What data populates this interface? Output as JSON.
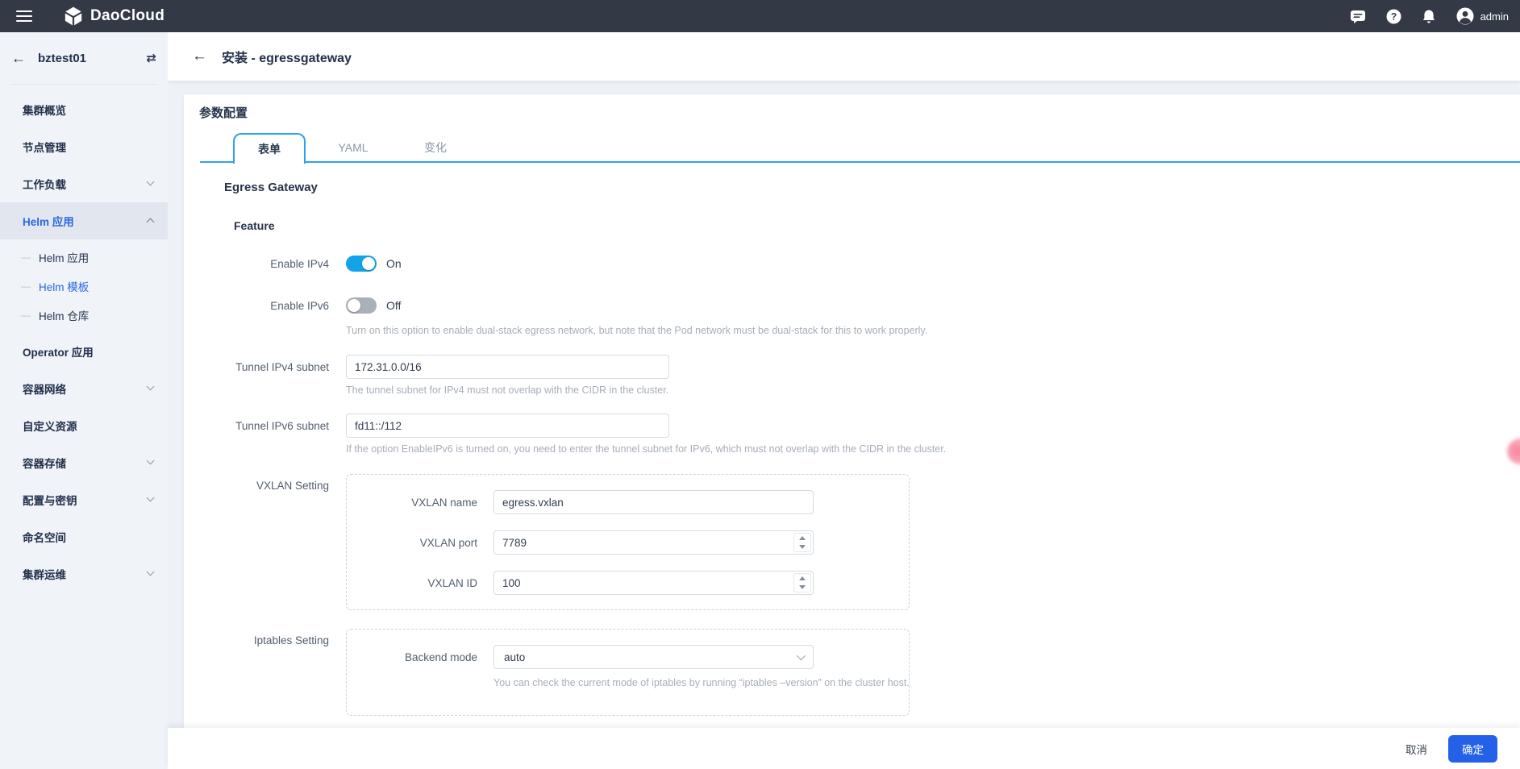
{
  "navbar": {
    "brand": "DaoCloud",
    "username": "admin"
  },
  "sidebar": {
    "cluster": "bztest01",
    "items": [
      {
        "label": "集群概览",
        "type": "main"
      },
      {
        "label": "节点管理",
        "type": "main"
      },
      {
        "label": "工作负载",
        "type": "main",
        "chevron": "down"
      },
      {
        "label": "Helm 应用",
        "type": "main",
        "chevron": "up",
        "active": true
      },
      {
        "label": "Helm 应用",
        "type": "sub"
      },
      {
        "label": "Helm 模板",
        "type": "sub",
        "active": true
      },
      {
        "label": "Helm 仓库",
        "type": "sub"
      },
      {
        "label": "Operator 应用",
        "type": "main"
      },
      {
        "label": "容器网络",
        "type": "main",
        "chevron": "down"
      },
      {
        "label": "自定义资源",
        "type": "main"
      },
      {
        "label": "容器存储",
        "type": "main",
        "chevron": "down"
      },
      {
        "label": "配置与密钥",
        "type": "main",
        "chevron": "down"
      },
      {
        "label": "命名空间",
        "type": "main"
      },
      {
        "label": "集群运维",
        "type": "main",
        "chevron": "down"
      }
    ]
  },
  "header": {
    "title": "安装 - egressgateway"
  },
  "panel": {
    "title": "参数配置",
    "tabs": [
      {
        "label": "表单",
        "active": true
      },
      {
        "label": "YAML",
        "active": false
      },
      {
        "label": "变化",
        "active": false
      }
    ]
  },
  "form": {
    "section_title": "Egress Gateway",
    "group_title": "Feature",
    "toggle_ipv4": {
      "label": "Enable IPv4",
      "state": "On"
    },
    "toggle_ipv6": {
      "label": "Enable IPv6",
      "state": "Off",
      "description": "Turn on this option to enable dual-stack egress network, but note that the Pod network must be dual-stack for this to work properly."
    },
    "tunnel_ipv4": {
      "label": "Tunnel IPv4 subnet",
      "value": "172.31.0.0/16",
      "helper": "The tunnel subnet for IPv4 must not overlap with the CIDR in the cluster."
    },
    "tunnel_ipv6": {
      "label": "Tunnel IPv6 subnet",
      "value": "fd11::/112",
      "helper": "If the option EnableIPv6 is turned on, you need to enter the tunnel subnet for IPv6, which must not overlap with the CIDR in the cluster."
    },
    "vxlan": {
      "title": "VXLAN Setting",
      "name": {
        "label": "VXLAN name",
        "value": "egress.vxlan"
      },
      "port": {
        "label": "VXLAN port",
        "value": "7789"
      },
      "id": {
        "label": "VXLAN ID",
        "value": "100"
      }
    },
    "iptables": {
      "title": "Iptables Setting",
      "backend": {
        "label": "Backend mode",
        "value": "auto"
      },
      "helper": "You can check the current mode of iptables by running “iptables –version” on the cluster host."
    }
  },
  "footer": {
    "cancel": "取消",
    "confirm": "确定"
  },
  "colors": {
    "navbar_bg": "#333a46",
    "sidebar_bg": "#f0f4f9",
    "active_link_blue": "#2968dd",
    "tab_accent_blue": "#2f9ff2",
    "toggle_on_blue": "#12a3e8",
    "confirm_button_blue": "#2461e9"
  }
}
